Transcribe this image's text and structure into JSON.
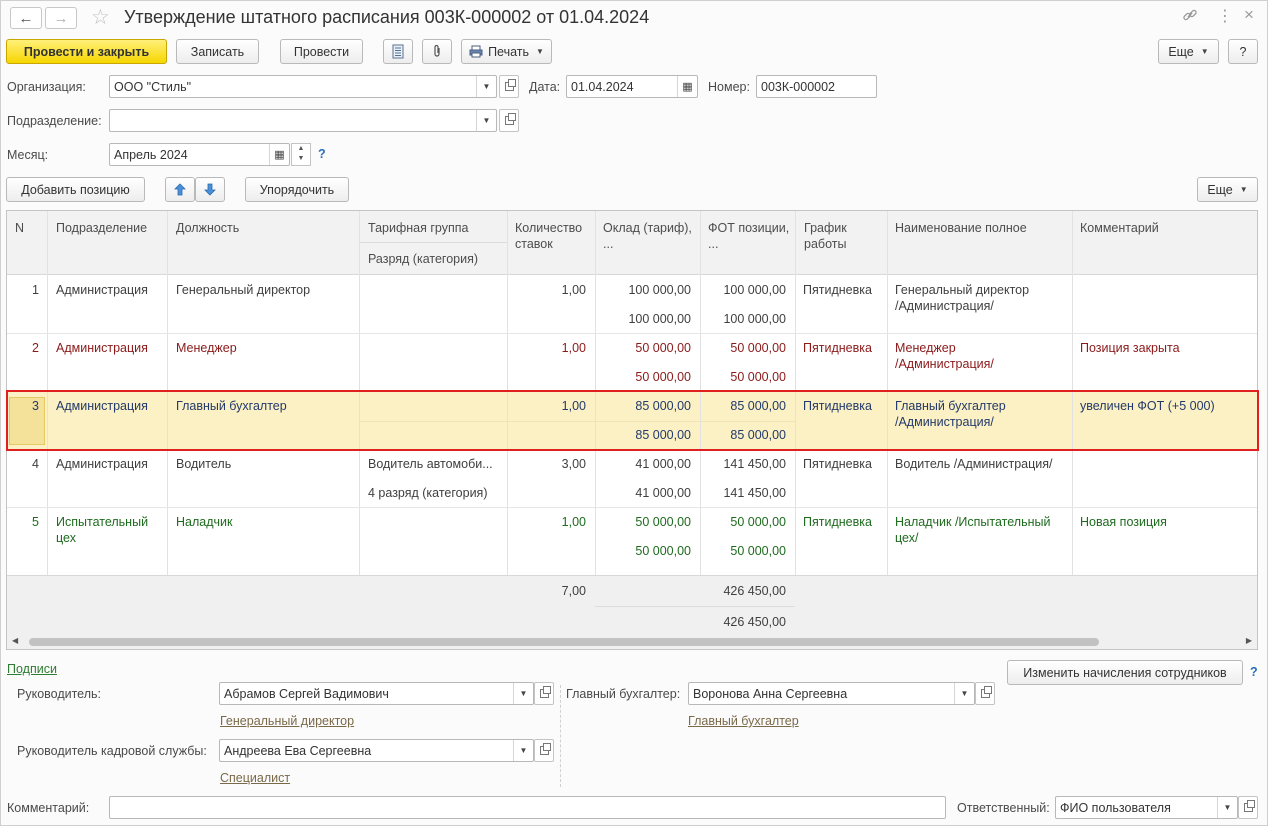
{
  "window": {
    "title": "Утверждение штатного расписания 003К-000002 от 01.04.2024"
  },
  "toolbar": {
    "post_close": "Провести и закрыть",
    "save": "Записать",
    "post": "Провести",
    "print": "Печать",
    "more": "Еще",
    "help": "?"
  },
  "form": {
    "org_label": "Организация:",
    "org_value": "ООО \"Стиль\"",
    "date_label": "Дата:",
    "date_value": "01.04.2024",
    "number_label": "Номер:",
    "number_value": "003К-000002",
    "dept_label": "Подразделение:",
    "dept_value": "",
    "month_label": "Месяц:",
    "month_value": "Апрель 2024",
    "month_help": "?"
  },
  "table_toolbar": {
    "add": "Добавить позицию",
    "sort": "Упорядочить",
    "more": "Еще"
  },
  "table": {
    "headers": {
      "n": "N",
      "dept": "Подразделение",
      "position": "Должность",
      "tariff_group": "Тарифная группа",
      "rank": "Разряд (категория)",
      "rates": "Количество ставок",
      "salary": "Оклад (тариф), ...",
      "fot": "ФОТ позиции, ...",
      "schedule": "График работы",
      "fullname": "Наименование полное",
      "comment": "Комментарий"
    },
    "rows": [
      {
        "n": "1",
        "dept": "Администрация",
        "dept2": "",
        "position": "Генеральный директор",
        "tariff": "",
        "rank": "",
        "rates": "1,00",
        "salary": "100 000,00",
        "salary2": "100 000,00",
        "fot": "100 000,00",
        "fot2": "100 000,00",
        "schedule": "Пятидневка",
        "full1": "Генеральный директор",
        "full2": "/Администрация/",
        "comment": ""
      },
      {
        "n": "2",
        "dept": "Администрация",
        "dept2": "",
        "position": "Менеджер",
        "tariff": "",
        "rank": "",
        "rates": "1,00",
        "salary": "50 000,00",
        "salary2": "50 000,00",
        "fot": "50 000,00",
        "fot2": "50 000,00",
        "schedule": "Пятидневка",
        "full1": "Менеджер",
        "full2": "/Администрация/",
        "comment": "Позиция закрыта"
      },
      {
        "n": "3",
        "dept": "Администрация",
        "dept2": "",
        "position": "Главный бухгалтер",
        "tariff": "",
        "rank": "",
        "rates": "1,00",
        "salary": "85 000,00",
        "salary2": "85 000,00",
        "fot": "85 000,00",
        "fot2": "85 000,00",
        "schedule": "Пятидневка",
        "full1": "Главный бухгалтер",
        "full2": "/Администрация/",
        "comment": "увеличен ФОТ (+5 000)"
      },
      {
        "n": "4",
        "dept": "Администрация",
        "dept2": "",
        "position": "Водитель",
        "tariff": "Водитель автомоби...",
        "rank": "4 разряд (категория)",
        "rates": "3,00",
        "salary": "41 000,00",
        "salary2": "41 000,00",
        "fot": "141 450,00",
        "fot2": "141 450,00",
        "schedule": "Пятидневка",
        "full1": "Водитель /Администрация/",
        "full2": "",
        "comment": ""
      },
      {
        "n": "5",
        "dept": "Испытательный",
        "dept2": "цех",
        "position": "Наладчик",
        "tariff": "",
        "rank": "",
        "rates": "1,00",
        "salary": "50 000,00",
        "salary2": "50 000,00",
        "fot": "50 000,00",
        "fot2": "50 000,00",
        "schedule": "Пятидневка",
        "full1": "Наладчик /Испытательный",
        "full2": "цех/",
        "comment": "Новая позиция"
      }
    ],
    "totals": {
      "rates": "7,00",
      "fot": "426 450,00",
      "fot2": "426 450,00"
    }
  },
  "signatures": {
    "section_link": "Подписи",
    "change_button": "Изменить начисления сотрудников",
    "help": "?",
    "head_label": "Руководитель:",
    "head_value": "Абрамов Сергей Вадимович",
    "head_position": "Генеральный директор",
    "chief_acc_label": "Главный бухгалтер:",
    "chief_acc_value": "Воронова Анна Сергеевна",
    "chief_acc_position": "Главный бухгалтер",
    "hr_label": "Руководитель кадровой службы:",
    "hr_value": "Андреева Ева Сергеевна",
    "hr_position": "Специалист"
  },
  "bottom": {
    "comment_label": "Комментарий:",
    "comment_value": "",
    "responsible_label": "Ответственный:",
    "responsible_value": "ФИО пользователя"
  },
  "colors": {
    "primary_button": "#f6d600",
    "selected_row": "#fbf1c4",
    "selection_border": "#e02020",
    "closed_row": "#8b1a1a",
    "new_row": "#1e6b1e"
  }
}
